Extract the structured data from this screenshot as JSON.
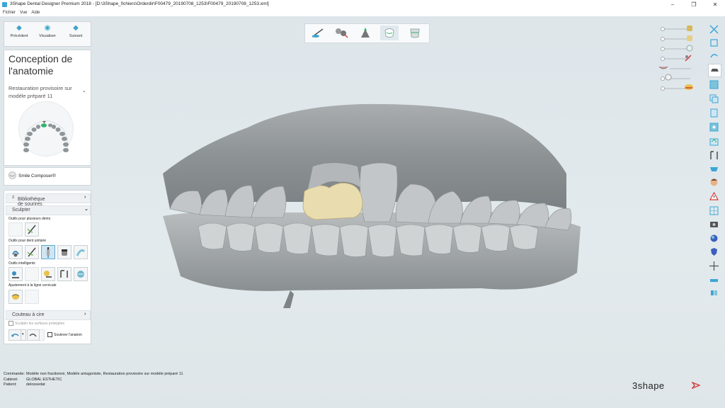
{
  "window": {
    "title": "3Shape Dental Designer Premium 2018 - [D:\\3Shape_fichiers\\Orderdir\\F00479_20190708_1253\\F00479_20190708_1253.xml]",
    "controls": [
      "–",
      "❐",
      "✕"
    ]
  },
  "menu": [
    "Fichier",
    "Vue",
    "Aide"
  ],
  "nav": {
    "prev_label": "Précédent",
    "view_label": "Visualiser",
    "next_label": "Suivant"
  },
  "panel": {
    "title": "Conception de l'anatomie",
    "subtitle": "Restauration provisoire sur modèle préparé 11"
  },
  "smile_composer": {
    "label": "Smile Composer®"
  },
  "tools": {
    "library_label": "Bibliothèque de sourires",
    "library_sup": "2",
    "sculpt_label": "Sculpter",
    "multi_label": "Outils pour plusieurs dents",
    "single_label": "Outils pour dent unitaire",
    "smart_label": "Outils intelligents",
    "cervical_label": "Ajustement à la ligne cervicale",
    "wax_label": "Couteau à cire",
    "protected_label": "Sculpter les surfaces protégées",
    "antagonist_label": "Soulever l'anatom"
  },
  "status": {
    "command_key": "Commande:",
    "command_val": "Modèle non fractionné, Modèle antagoniste, Restauration provisoire sur modèle préparé 11",
    "cabinet_key": "Cabinet:",
    "cabinet_val": "GLOBAL ESTHETIC",
    "patient_key": "Patient:",
    "patient_val": "delossedat"
  },
  "brand": {
    "logo_text": "3shape"
  },
  "icons": {
    "top_toolbar": [
      "prepare-icon",
      "cut-icon",
      "scan-icon",
      "anatomy-icon",
      "final-icon"
    ],
    "right_toolbar": [
      "fullscreen-icon",
      "fit-icon",
      "rotate-icon",
      "hat-icon",
      "view-1-icon",
      "view-2-icon",
      "view-3-icon",
      "view-4-icon",
      "view-5-icon",
      "bracket-icon",
      "tooth-view-icon",
      "face-icon",
      "warning-icon",
      "grid-icon",
      "camera-icon",
      "color-icon",
      "shield-icon",
      "cross-icon",
      "ruler-icon",
      "teeth-icon"
    ]
  },
  "colors": {
    "accent": "#3ca3c9",
    "restoration": "#e9dcae",
    "model": "#9aa0a3"
  }
}
